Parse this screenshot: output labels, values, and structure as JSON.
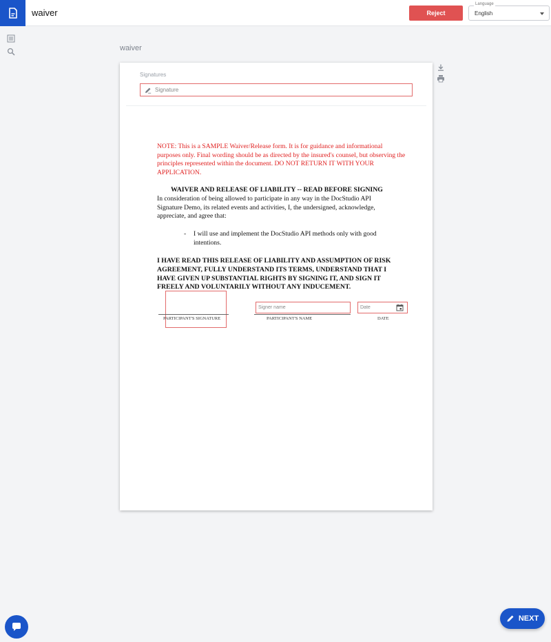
{
  "header": {
    "title": "waiver",
    "reject_label": "Reject",
    "language_label": "Language",
    "language_value": "English"
  },
  "sidebar": {
    "icons": [
      "list-icon",
      "search-icon"
    ]
  },
  "document": {
    "name": "waiver",
    "signatures_label": "Signatures",
    "signature_field_placeholder": "Signature",
    "note": "NOTE: This is a SAMPLE Waiver/Release form. It is for guidance and informational purposes only. Final wording should be as directed by the insured's counsel, but observing the principles represented within the document. DO NOT RETURN IT WITH YOUR APPLICATION.",
    "heading": "WAIVER AND RELEASE OF LIABILITY -- READ BEFORE SIGNING",
    "intro": "In consideration of being allowed to participate in any way in the DocStudio API Signature Demo, its related events and activities, I, the undersigned, acknowledge, appreciate, and agree that:",
    "bullet_dash": "-",
    "bullet_text": "I will use and implement the DocStudio API methods only with good intentions.",
    "acknowledgement": "I HAVE READ THIS RELEASE OF LIABILITY AND ASSUMPTION OF RISK AGREEMENT, FULLY UNDERSTAND ITS TERMS, UNDERSTAND THAT I HAVE GIVEN UP SUBSTANTIAL RIGHTS BY SIGNING IT, AND SIGN IT FREELY AND VOLUNTARILY WITHOUT ANY INDUCEMENT.",
    "signer_name_placeholder": "Signer name",
    "date_placeholder": "Date",
    "caption_signature": "PARTICIPANT'S SIGNATURE",
    "caption_name": "PARTICIPANT'S NAME",
    "caption_date": "DATE"
  },
  "tools": {
    "icons": [
      "download-icon",
      "print-icon"
    ]
  },
  "footer": {
    "next_label": "NEXT"
  },
  "colors": {
    "brand": "#1a55c9",
    "reject": "#e05252",
    "field_border": "#e26a6a",
    "note_text": "#e02020"
  }
}
